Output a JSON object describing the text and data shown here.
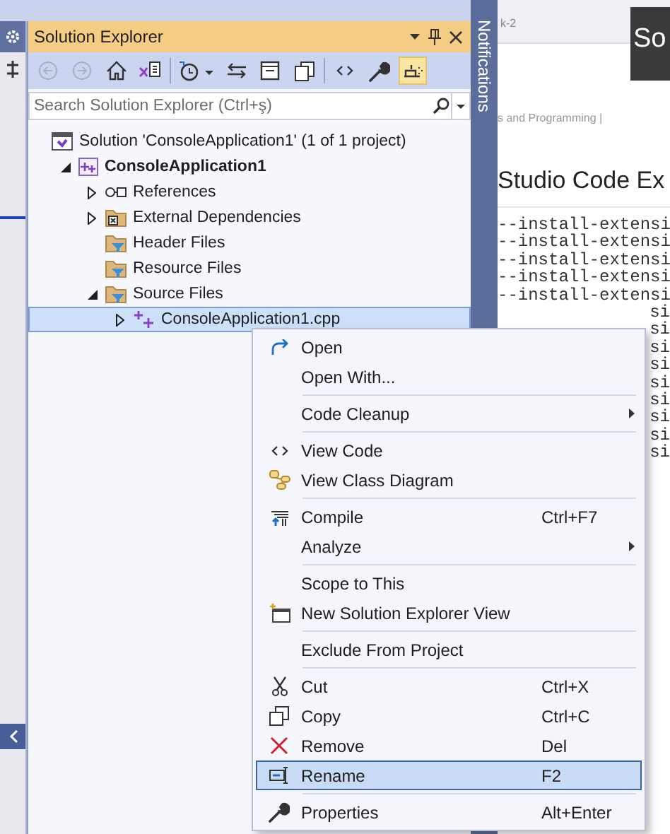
{
  "panel": {
    "title": "Solution Explorer",
    "search": {
      "placeholder": "Search Solution Explorer (Ctrl+ş)"
    },
    "tree": [
      {
        "kind": "solution",
        "label": "Solution 'ConsoleApplication1' (1 of 1 project)",
        "children": [
          {
            "kind": "project",
            "label": "ConsoleApplication1",
            "expanded": true,
            "children": [
              {
                "kind": "references",
                "label": "References",
                "expanded": false
              },
              {
                "kind": "external",
                "label": "External Dependencies",
                "expanded": false
              },
              {
                "kind": "filter",
                "label": "Header Files"
              },
              {
                "kind": "filter",
                "label": "Resource Files"
              },
              {
                "kind": "filter",
                "label": "Source Files",
                "expanded": true,
                "children": [
                  {
                    "kind": "cpp",
                    "label": "ConsoleApplication1.cpp",
                    "expanded": false,
                    "selected": true
                  }
                ]
              }
            ]
          }
        ]
      }
    ]
  },
  "notifications_tab": {
    "label": "Notifications"
  },
  "browser": {
    "tab_fragment": "k-2",
    "banner": "So",
    "breadcrumb": "s and Programming |",
    "heading": "Studio Code Ex",
    "code_lines": [
      "--install-extensi",
      "--install-extensi",
      "--install-extensi",
      "--install-extensi",
      "--install-extensi",
      "si",
      "si",
      "si",
      "si",
      "si",
      "si",
      "si",
      "si",
      "si"
    ]
  },
  "context_menu": {
    "items": [
      {
        "kind": "open",
        "label": "Open",
        "selected": false
      },
      {
        "kind": "plain",
        "label": "Open With...",
        "selected": false
      },
      {
        "kind": "separator"
      },
      {
        "kind": "submenu",
        "label": "Code Cleanup",
        "selected": false
      },
      {
        "kind": "separator"
      },
      {
        "kind": "code",
        "label": "View Code",
        "selected": false
      },
      {
        "kind": "diagram",
        "label": "View Class Diagram",
        "selected": false
      },
      {
        "kind": "separator"
      },
      {
        "kind": "compile",
        "label": "Compile",
        "shortcut": "Ctrl+F7",
        "selected": false
      },
      {
        "kind": "submenu",
        "label": "Analyze",
        "selected": false
      },
      {
        "kind": "separator"
      },
      {
        "kind": "plain",
        "label": "Scope to This",
        "selected": false
      },
      {
        "kind": "newview",
        "label": "New Solution Explorer View",
        "selected": false
      },
      {
        "kind": "separator"
      },
      {
        "kind": "plain",
        "label": "Exclude From Project",
        "selected": false
      },
      {
        "kind": "separator"
      },
      {
        "kind": "cut",
        "label": "Cut",
        "shortcut": "Ctrl+X",
        "selected": false
      },
      {
        "kind": "copy",
        "label": "Copy",
        "shortcut": "Ctrl+C",
        "selected": false
      },
      {
        "kind": "remove",
        "label": "Remove",
        "shortcut": "Del",
        "selected": false
      },
      {
        "kind": "rename",
        "label": "Rename",
        "shortcut": "F2",
        "selected": true
      },
      {
        "kind": "separator"
      },
      {
        "kind": "wrench",
        "label": "Properties",
        "shortcut": "Alt+Enter",
        "selected": false
      }
    ]
  }
}
